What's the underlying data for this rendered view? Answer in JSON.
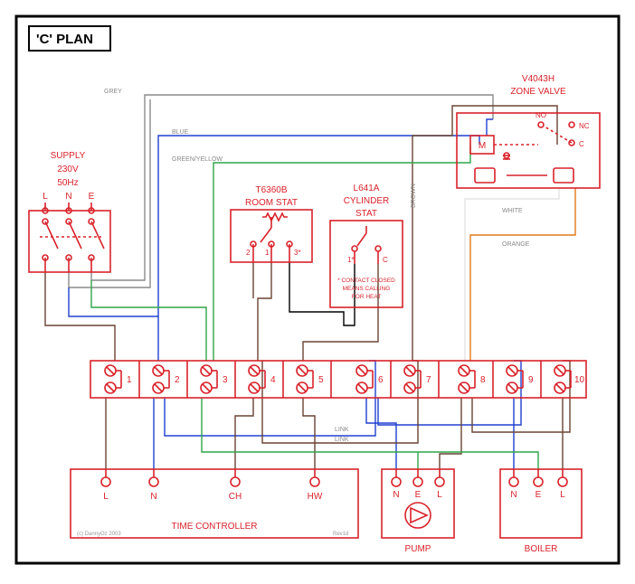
{
  "title": "'C' PLAN",
  "supply": {
    "label": "SUPPLY",
    "voltage": "230V",
    "freq": "50Hz",
    "terms": [
      "L",
      "N",
      "E"
    ]
  },
  "roomstat": {
    "model": "T6360B",
    "label": "ROOM STAT",
    "terms": [
      "2",
      "1",
      "3*"
    ]
  },
  "cylstat": {
    "model": "L641A",
    "label1": "CYLINDER",
    "label2": "STAT",
    "terms": [
      "1*",
      "C"
    ],
    "note1": "* CONTACT CLOSED",
    "note2": "MEANS CALLING",
    "note3": "FOR HEAT"
  },
  "zonevalve": {
    "model": "V4043H",
    "label": "ZONE VALVE",
    "m": "M",
    "no": "NO",
    "nc": "NC",
    "c": "C"
  },
  "junction": {
    "terms": [
      "1",
      "2",
      "3",
      "4",
      "5",
      "6",
      "7",
      "8",
      "9",
      "10"
    ],
    "link": "LINK"
  },
  "timecontroller": {
    "label": "TIME CONTROLLER",
    "terms": [
      "L",
      "N",
      "CH",
      "HW"
    ]
  },
  "pump": {
    "label": "PUMP",
    "terms": [
      "N",
      "E",
      "L"
    ]
  },
  "boiler": {
    "label": "BOILER",
    "terms": [
      "N",
      "E",
      "L"
    ]
  },
  "footer": {
    "copyright": "(c) DannyOz 2003",
    "rev": "Rev1d"
  },
  "wire_labels": {
    "grey": "GREY",
    "blue": "BLUE",
    "greenyellow": "GREEN/YELLOW",
    "brown": "BROWN",
    "white": "WHITE",
    "orange": "ORANGE"
  }
}
